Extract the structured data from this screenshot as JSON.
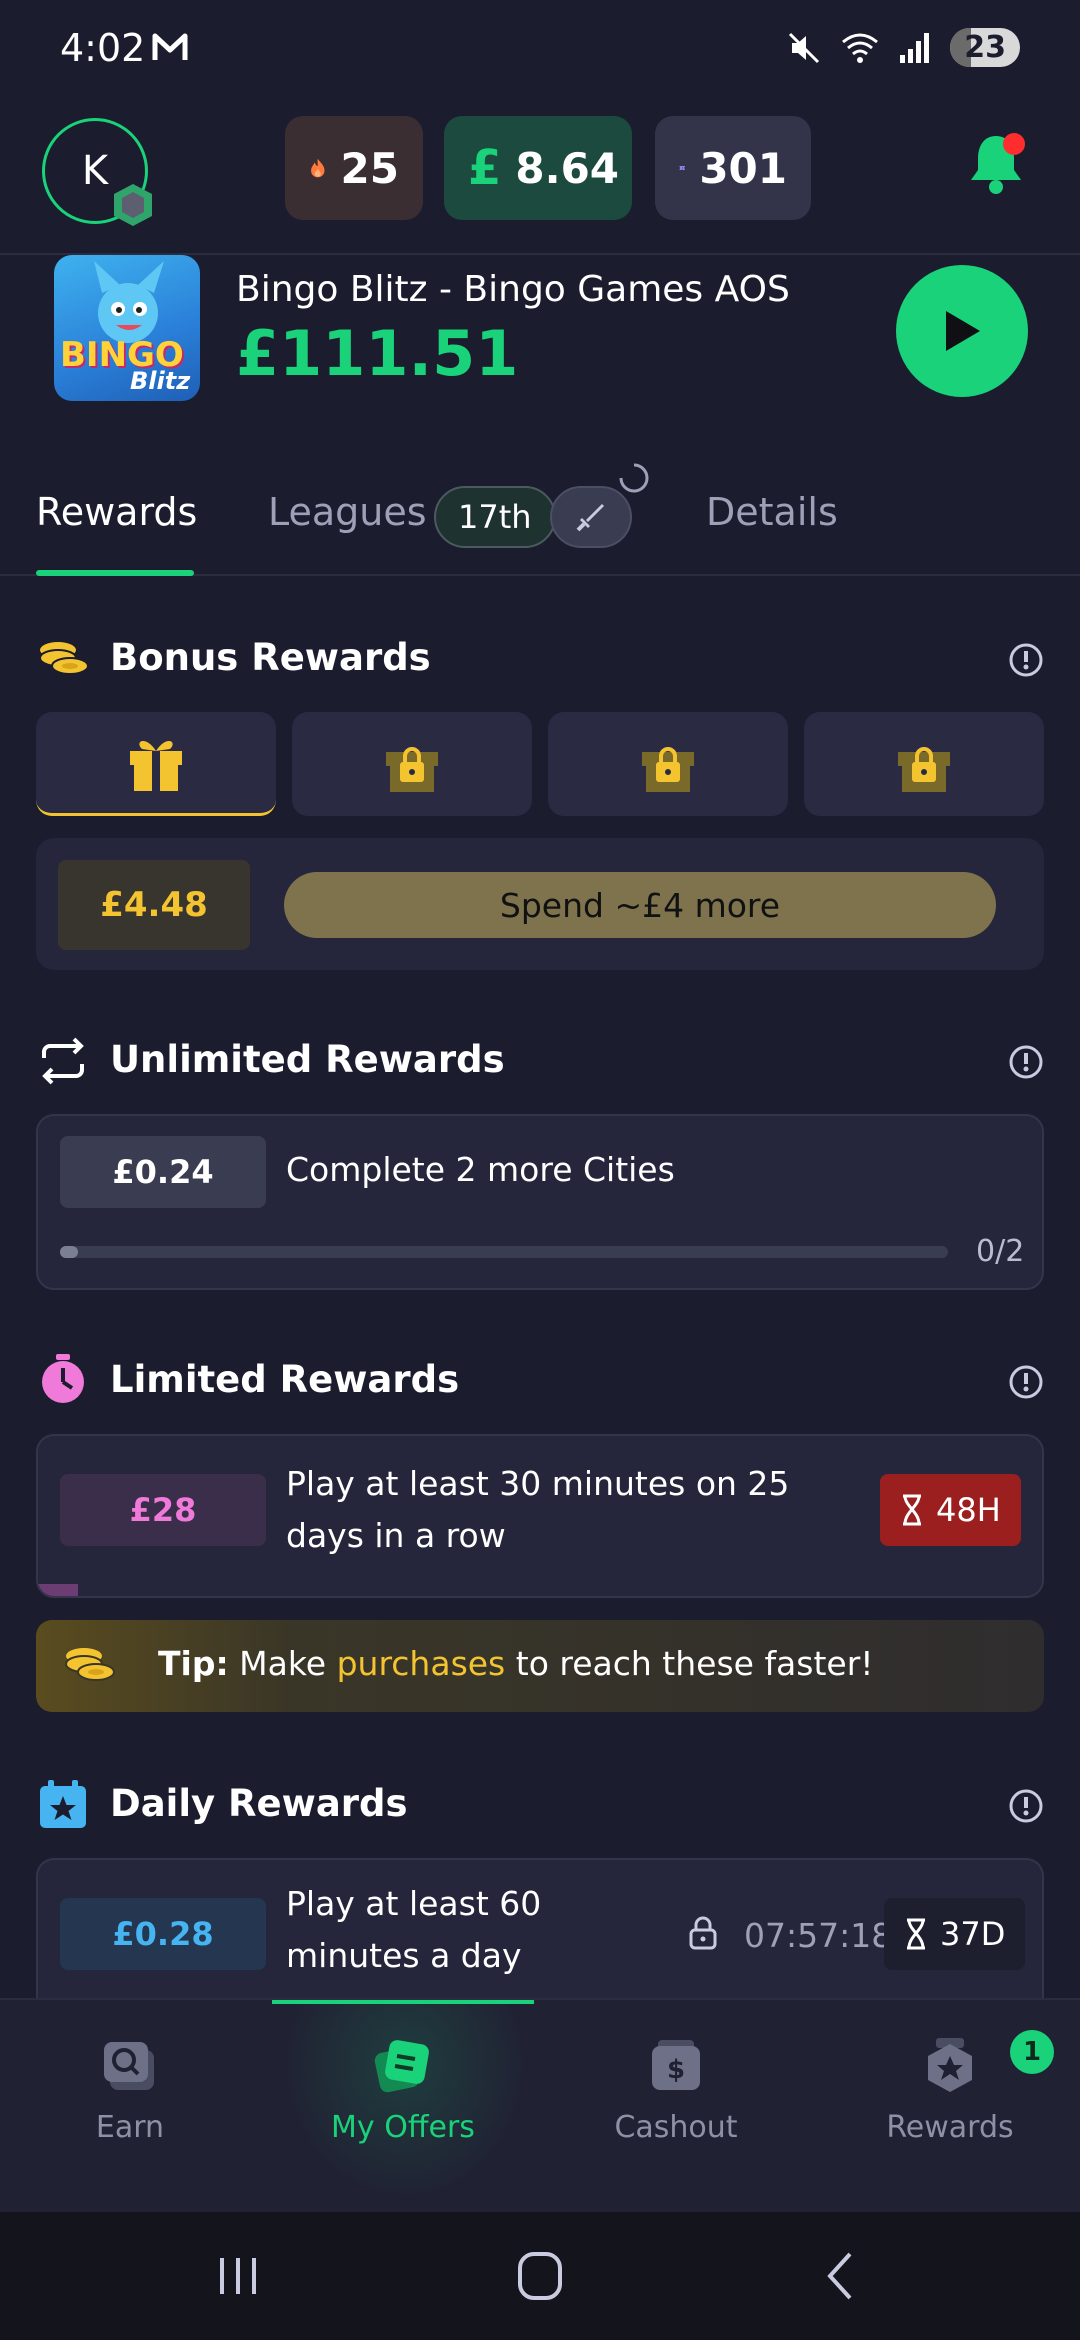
{
  "status_bar": {
    "time": "4:02",
    "battery": "23"
  },
  "header": {
    "avatar_letter": "K",
    "streak": "25",
    "cash": "8.64",
    "tickets": "301",
    "colors": {
      "accent": "#19d27a",
      "notification_dot": "#ff2d2d"
    }
  },
  "game": {
    "title": "Bingo Blitz - Bingo Games AOS",
    "amount": "£111.51",
    "icon_text_1": "BINGO",
    "icon_text_2": "Blitz"
  },
  "tabs": {
    "rewards": "Rewards",
    "leagues": "Leagues",
    "league_rank": "17th",
    "details": "Details"
  },
  "bonus": {
    "title": "Bonus Rewards",
    "amount": "£4.48",
    "cta": "Spend ~£4 more"
  },
  "unlimited": {
    "title": "Unlimited Rewards",
    "amount": "£0.24",
    "task": "Complete 2 more Cities",
    "progress_text": "0/2",
    "progress_fraction": 0.02
  },
  "limited": {
    "title": "Limited Rewards",
    "amount": "£28",
    "task_line1": "Play at least 30 minutes on 25",
    "task_line2": "days in a row",
    "timer": "48H",
    "progress_fraction": 0.04
  },
  "tip": {
    "label": "Tip:",
    "pre": "Make",
    "link": "purchases",
    "post": "to reach these faster!"
  },
  "daily": {
    "title": "Daily Rewards",
    "amount": "£0.28",
    "task_line1": "Play at least 60",
    "task_line2": "minutes a day",
    "countdown": "07:57:18",
    "remaining": "37D"
  },
  "bottom_nav": {
    "earn": "Earn",
    "my_offers": "My Offers",
    "cashout": "Cashout",
    "rewards": "Rewards",
    "rewards_badge": "1"
  }
}
